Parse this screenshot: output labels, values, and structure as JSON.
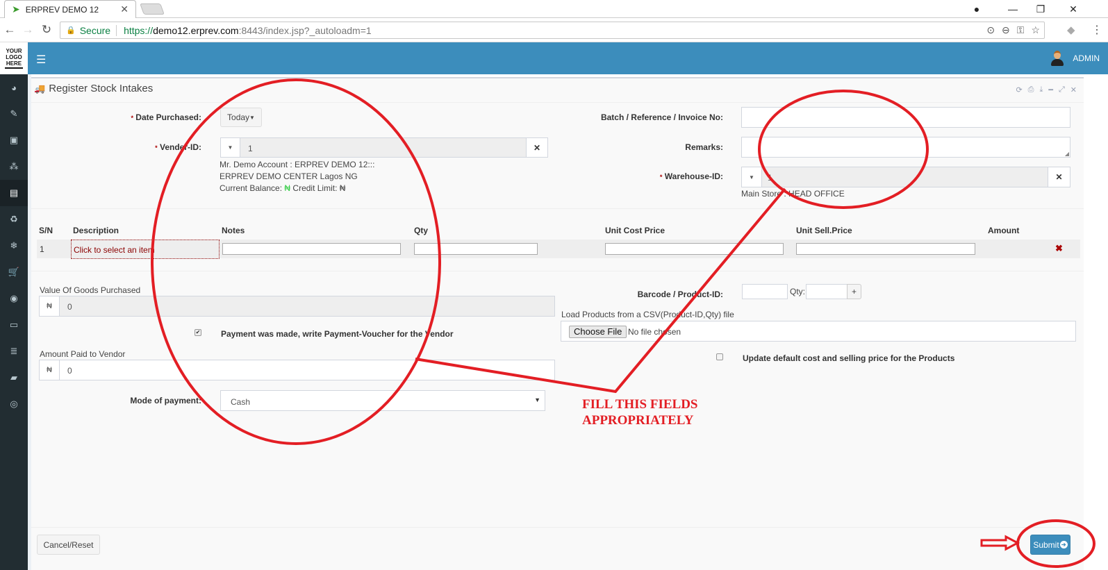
{
  "browser": {
    "tab_title": "ERPREV DEMO 12",
    "tab_icon": "bird-favicon-icon",
    "secure_label": "Secure",
    "url_scheme": "https://",
    "url_host": "demo12.erprev.com",
    "url_rest": ":8443/index.jsp?_autoloadm=1"
  },
  "header": {
    "logo_lines": [
      "YOUR",
      "LOGO",
      "HERE"
    ],
    "user_name": "ADMIN"
  },
  "sidebar": {
    "items": [
      {
        "icon": "dashboard-icon",
        "glyph": "◕"
      },
      {
        "icon": "ticket-icon",
        "glyph": "✎"
      },
      {
        "icon": "money-icon",
        "glyph": "▣"
      },
      {
        "icon": "cubes-icon",
        "glyph": "⁂"
      },
      {
        "icon": "calculator-icon",
        "glyph": "▤",
        "active": true
      },
      {
        "icon": "trash-icon",
        "glyph": "♻"
      },
      {
        "icon": "snowflake-icon",
        "glyph": "❄"
      },
      {
        "icon": "cart-icon",
        "glyph": "🛒"
      },
      {
        "icon": "record-icon",
        "glyph": "◉"
      },
      {
        "icon": "desktop-icon",
        "glyph": "▭"
      },
      {
        "icon": "database-icon",
        "glyph": "≣"
      },
      {
        "icon": "book-icon",
        "glyph": "▰"
      },
      {
        "icon": "lifebuoy-icon",
        "glyph": "◎"
      }
    ]
  },
  "panel": {
    "title": "Register Stock Intakes",
    "tools": [
      "refresh-icon",
      "print-icon",
      "download-icon",
      "minimize-icon",
      "expand-icon",
      "close-icon"
    ]
  },
  "form": {
    "date_purchased": {
      "label": "Date Purchased:",
      "required": "*",
      "value": "Today"
    },
    "vendor": {
      "label": "Vender-ID:",
      "required": "*",
      "value": "1",
      "info_line1": "Mr. Demo Account : ERPREV DEMO 12:::",
      "info_line2": "ERPREV DEMO CENTER Lagos NG",
      "balance_label": "Current Balance:",
      "balance_currency": "₦",
      "credit_label": "Credit Limit:",
      "credit_currency": "₦"
    },
    "batch": {
      "label": "Batch / Reference / Invoice No:",
      "value": ""
    },
    "remarks": {
      "label": "Remarks:",
      "value": ""
    },
    "warehouse": {
      "label": "Warehouse-ID:",
      "required": "*",
      "value": "1",
      "info": "Main Store : HEAD OFFICE"
    }
  },
  "items_table": {
    "columns": [
      "S/N",
      "Description",
      "Notes",
      "Qty",
      "Unit Cost Price",
      "Unit Sell.Price",
      "Amount"
    ],
    "rows": [
      {
        "sn": "1",
        "description": "Click to select an item",
        "notes": "",
        "qty": "",
        "unit_cost": "",
        "unit_sell": "",
        "amount": ""
      }
    ]
  },
  "summary": {
    "value_of_goods_label": "Value Of Goods Purchased",
    "currency": "₦",
    "value_of_goods": "0",
    "payment_made_label": "Payment was made, write Payment-Voucher for the Vendor",
    "payment_made_checked": true,
    "amount_paid_label": "Amount Paid to Vendor",
    "amount_paid": "0",
    "mode_label": "Mode of payment:",
    "mode_value": "Cash"
  },
  "barcode": {
    "label": "Barcode / Product-ID:",
    "value": "",
    "qty_label": "Qty:",
    "qty_value": "",
    "add_label": "+"
  },
  "csv": {
    "label": "Load Products from a CSV(Product-ID,Qty) file",
    "button": "Choose File",
    "status": "No file chosen"
  },
  "update_prices": {
    "label": "Update default cost and selling price for the Products",
    "checked": false
  },
  "footer": {
    "cancel_label": "Cancel/Reset",
    "submit_label": "Submit"
  },
  "annotation": {
    "line1": "FILL THIS FIELDS",
    "line2": "APPROPRIATELY",
    "color": "#e31e24"
  }
}
